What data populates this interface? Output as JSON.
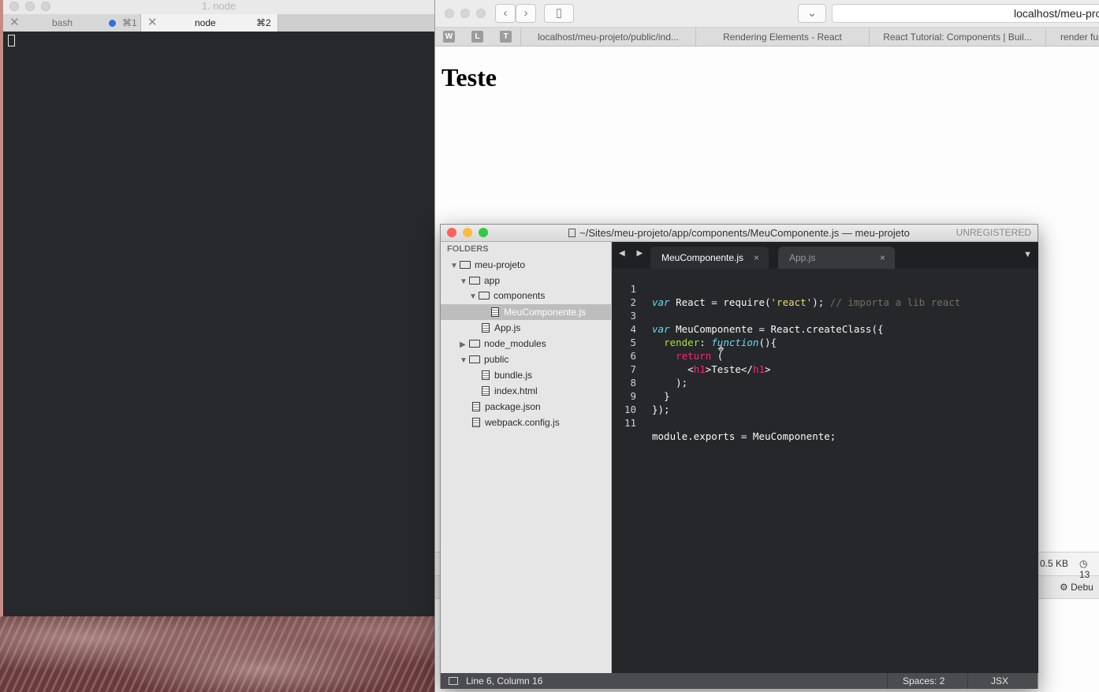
{
  "terminal": {
    "title": "1. node",
    "tabs": [
      {
        "label": "bash",
        "shortcut": "⌘1"
      },
      {
        "label": "node",
        "shortcut": "⌘2"
      }
    ]
  },
  "browser": {
    "address": "localhost/meu-proje",
    "favicons": [
      "W",
      "L",
      "T"
    ],
    "tabs": [
      "localhost/meu-projeto/public/ind...",
      "Rendering Elements - React",
      "React Tutorial: Components | Buil...",
      "render fun"
    ],
    "page_heading": "Teste",
    "devtools": {
      "size": "0.5 KB",
      "clock": "13",
      "debug": "Debu"
    }
  },
  "sublime": {
    "title": "~/Sites/meu-projeto/app/components/MeuComponente.js — meu-projeto",
    "unregistered": "UNREGISTERED",
    "sidebar_header": "FOLDERS",
    "tree": {
      "root": "meu-projeto",
      "app": "app",
      "components": "components",
      "meucomponente": "MeuComponente.js",
      "appjs": "App.js",
      "node_modules": "node_modules",
      "public": "public",
      "bundle": "bundle.js",
      "index": "index.html",
      "package": "package.json",
      "webpack": "webpack.config.js"
    },
    "tabs": [
      {
        "label": "MeuComponente.js",
        "close": "×"
      },
      {
        "label": "App.js",
        "close": "×"
      }
    ],
    "line_numbers": [
      "1",
      "2",
      "3",
      "4",
      "5",
      "6",
      "7",
      "8",
      "9",
      "10",
      "11"
    ],
    "code": {
      "l1_var": "var",
      "l1_rest": " React = require(",
      "l1_str": "'react'",
      "l1_end": ");",
      "l1_comment": " // importa a lib react",
      "l3_var": "var",
      "l3_rest": " MeuComponente = React.createClass({",
      "l4_key": "render",
      "l4_colon": ": ",
      "l4_fn": "function",
      "l4_end": "(){",
      "l5_ret": "return",
      "l5_end": " (",
      "l6_lt": "<",
      "l6_tag1": "h1",
      "l6_text": ">Teste</",
      "l6_tag2": "h1",
      "l6_gt": ">",
      "l7": ");",
      "l8": "}",
      "l9": "});",
      "l11": "module.exports = MeuComponente;"
    },
    "status": {
      "position": "Line 6, Column 16",
      "spaces": "Spaces: 2",
      "syntax": "JSX"
    }
  }
}
